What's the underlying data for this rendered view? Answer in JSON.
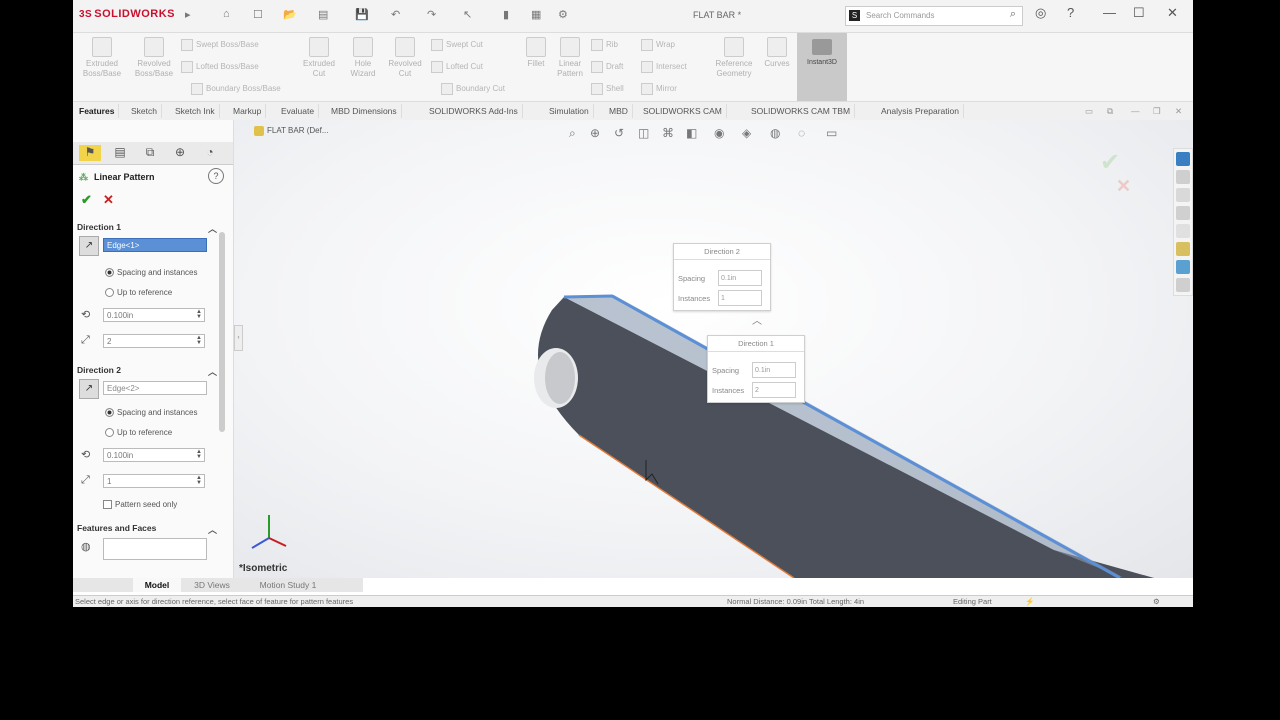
{
  "app": {
    "brand": "SOLIDWORKS",
    "brand_prefix": "3S",
    "document_title": "FLAT BAR *"
  },
  "search": {
    "icon_label": "S",
    "placeholder": "Search Commands"
  },
  "command_manager": {
    "large": [
      "Extruded Boss/Base",
      "Revolved Boss/Base",
      "Extruded Cut",
      "Hole Wizard",
      "Revolved Cut",
      "Fillet",
      "Linear Pattern",
      "Reference Geometry",
      "Curves",
      "Instant3D"
    ],
    "small": [
      "Swept Boss/Base",
      "Lofted Boss/Base",
      "Boundary Boss/Base",
      "Swept Cut",
      "Lofted Cut",
      "Boundary Cut",
      "Rib",
      "Draft",
      "Shell",
      "Wrap",
      "Intersect",
      "Mirror"
    ]
  },
  "tabs": [
    "Features",
    "Sketch",
    "Sketch Ink",
    "Markup",
    "Evaluate",
    "MBD Dimensions",
    "SOLIDWORKS Add-Ins",
    "Simulation",
    "MBD",
    "SOLIDWORKS CAM",
    "SOLIDWORKS CAM TBM",
    "Analysis Preparation"
  ],
  "property_manager": {
    "title": "Linear Pattern",
    "direction1": {
      "header": "Direction 1",
      "edge": "Edge<1>",
      "options": [
        "Spacing and instances",
        "Up to reference"
      ],
      "spacing": "0.100in",
      "instances": "2"
    },
    "direction2": {
      "header": "Direction 2",
      "edge": "Edge<2>",
      "options": [
        "Spacing and instances",
        "Up to reference"
      ],
      "spacing": "0.100in",
      "instances": "1",
      "seed_only": "Pattern seed only"
    },
    "features": {
      "header": "Features and Faces"
    }
  },
  "viewport": {
    "part_name": "FLAT BAR (Def...",
    "view_name": "*Isometric",
    "callout_dir2": {
      "title": "Direction 2",
      "spacing_label": "Spacing",
      "spacing_value": "0.1in",
      "instances_label": "Instances",
      "instances_value": "1"
    },
    "callout_dir1": {
      "title": "Direction 1",
      "spacing_label": "Spacing",
      "spacing_value": "0.1in",
      "instances_label": "Instances",
      "instances_value": "2"
    }
  },
  "bottom_tabs": [
    "Model",
    "3D Views",
    "Motion Study 1"
  ],
  "status": {
    "hint": "Select edge or axis for direction reference, select face of feature for pattern features",
    "measure": "Normal Distance: 0.09in Total Length: 4in",
    "mode": "Editing Part"
  },
  "colors": {
    "brand": "#c8102e",
    "part": "#4a4f5a",
    "selected_edge": "#5b8fd6",
    "accent": "#f2d44a"
  }
}
